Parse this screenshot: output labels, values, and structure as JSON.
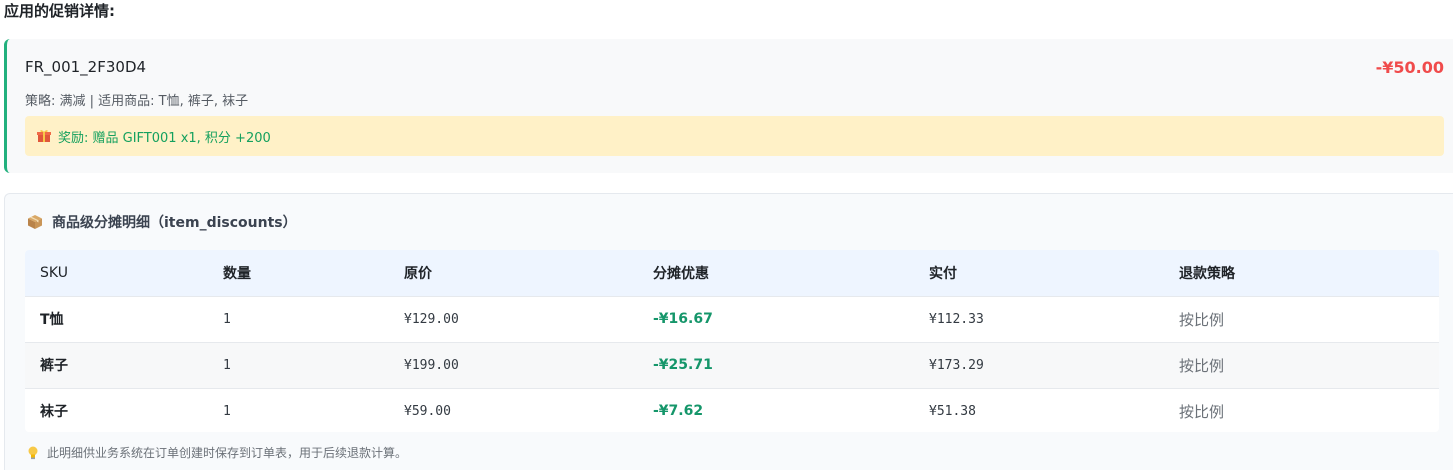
{
  "page": {
    "title": "应用的促销详情:"
  },
  "promotion": {
    "id": "FR_001_2F30D4",
    "amount": "-¥50.00",
    "meta": "策略: 满减 | 适用商品: T恤, 裤子, 袜子",
    "reward_icon": "gift-icon",
    "reward": "奖励: 赠品 GIFT001 x1, 积分 +200",
    "accent_color": "#22b07d",
    "amount_color": "#f04b4b",
    "reward_bg": "#fff1c7"
  },
  "item_discounts": {
    "icon": "package-box-icon",
    "title": "商品级分摊明细（item_discounts）",
    "columns": [
      "SKU",
      "数量",
      "原价",
      "分摊优惠",
      "实付",
      "退款策略"
    ],
    "rows": [
      {
        "sku": "T恤",
        "qty": "1",
        "price": "¥129.00",
        "discount": "-¥16.67",
        "paid": "¥112.33",
        "policy": "按比例"
      },
      {
        "sku": "裤子",
        "qty": "1",
        "price": "¥199.00",
        "discount": "-¥25.71",
        "paid": "¥173.29",
        "policy": "按比例"
      },
      {
        "sku": "袜子",
        "qty": "1",
        "price": "¥59.00",
        "discount": "-¥7.62",
        "paid": "¥51.38",
        "policy": "按比例"
      }
    ],
    "discount_color": "#15966a",
    "header_bg": "#eef5ff"
  },
  "footnote": {
    "icon": "lightbulb-icon",
    "text": "此明细供业务系统在订单创建时保存到订单表，用于后续退款计算。"
  }
}
